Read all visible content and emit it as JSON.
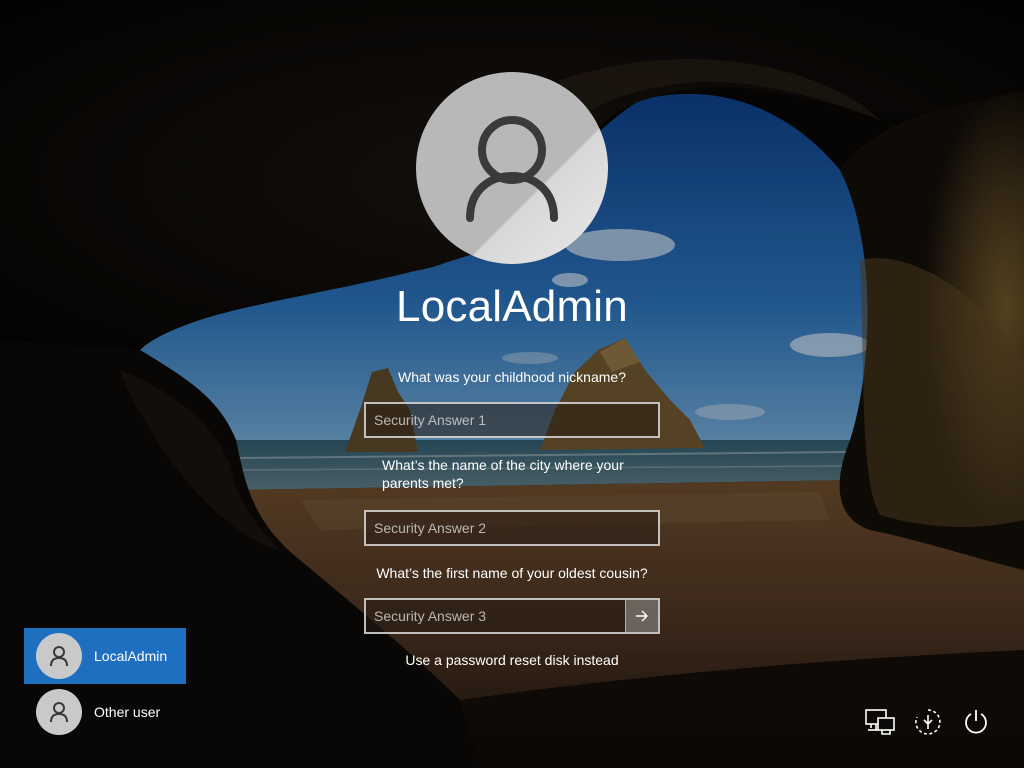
{
  "user": {
    "name": "LocalAdmin"
  },
  "security_questions": [
    {
      "question": "What was your childhood nickname?",
      "placeholder": "Security Answer 1"
    },
    {
      "question": "What’s the name of the city where your parents met?",
      "placeholder": "Security Answer 2"
    },
    {
      "question": "What’s the first name of your oldest cousin?",
      "placeholder": "Security Answer 3"
    }
  ],
  "reset_link": "Use a password reset disk instead",
  "user_list": [
    {
      "label": "LocalAdmin",
      "selected": true
    },
    {
      "label": "Other user",
      "selected": false
    }
  ],
  "icons": {
    "submit": "arrow-right-icon",
    "network": "network-icon",
    "ease_of_access": "ease-of-access-icon",
    "power": "power-icon",
    "user": "user-icon"
  },
  "colors": {
    "selected_tile": "#1f6fc0",
    "text": "#ffffff"
  }
}
